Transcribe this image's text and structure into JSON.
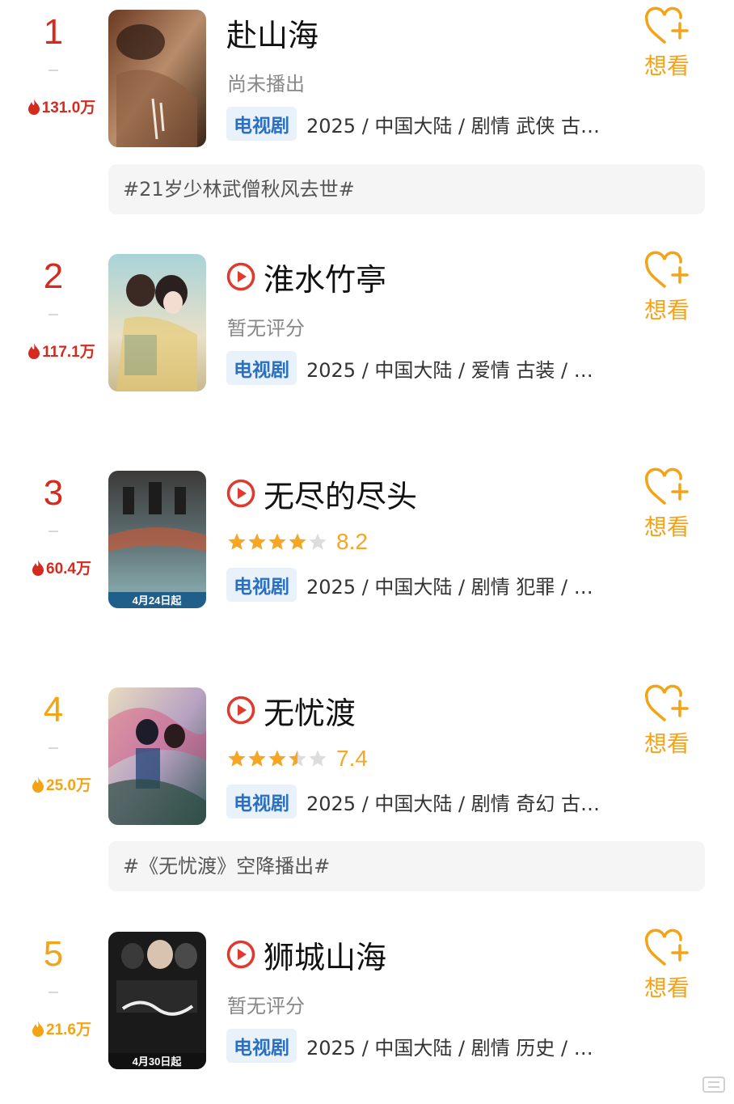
{
  "colors": {
    "rank_red": "#d42a1f",
    "rank_orange": "#f3a316",
    "star_filled": "#f6a623",
    "star_empty": "#dddddd",
    "tag_bg": "#e9f1fb",
    "tag_text": "#2a6fc0",
    "play_red": "#e03a2e"
  },
  "want_label": "想看",
  "items": [
    {
      "rank": "1",
      "heat": "131.0万",
      "title": "赴山海",
      "has_play_icon": false,
      "status_text": "尚未播出",
      "rating": null,
      "stars": null,
      "tag": "电视剧",
      "meta": "2025 / 中国大陆 / 剧情 武侠 古…",
      "topic": "#21岁少林武僧秋风去世#",
      "poster_icon": "poster-fushanhai"
    },
    {
      "rank": "2",
      "heat": "117.1万",
      "title": "淮水竹亭",
      "has_play_icon": true,
      "status_text": "暂无评分",
      "rating": null,
      "stars": null,
      "tag": "电视剧",
      "meta": "2025 / 中国大陆 / 爱情 古装 / …",
      "topic": null,
      "poster_icon": "poster-huaishuizhuting"
    },
    {
      "rank": "3",
      "heat": "60.4万",
      "title": "无尽的尽头",
      "has_play_icon": true,
      "status_text": null,
      "rating": "8.2",
      "stars": 4,
      "tag": "电视剧",
      "meta": "2025 / 中国大陆 / 剧情 犯罪 / …",
      "topic": null,
      "poster_text": "4月24日起",
      "poster_icon": "poster-wujindejintou"
    },
    {
      "rank": "4",
      "heat": "25.0万",
      "title": "无忧渡",
      "has_play_icon": true,
      "status_text": null,
      "rating": "7.4",
      "stars": 3.5,
      "tag": "电视剧",
      "meta": "2025 / 中国大陆 / 剧情 奇幻 古…",
      "topic": "#《无忧渡》空降播出#",
      "poster_icon": "poster-wuyoudu"
    },
    {
      "rank": "5",
      "heat": "21.6万",
      "title": "狮城山海",
      "has_play_icon": true,
      "status_text": "暂无评分",
      "rating": null,
      "stars": null,
      "tag": "电视剧",
      "meta": "2025 / 中国大陆 / 剧情 历史 / …",
      "topic": null,
      "poster_text": "4月30日起",
      "poster_icon": "poster-shichengshanhai"
    }
  ]
}
